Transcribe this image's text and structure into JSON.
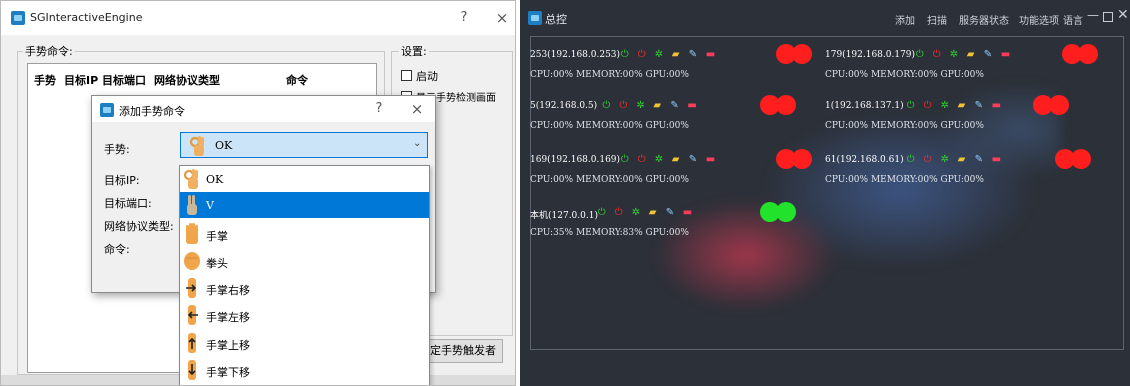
{
  "left_window": {
    "title": "SGInteractiveEngine",
    "help": "?",
    "close": "×",
    "gesture_cmd_group": "手势命令:",
    "table_headers": [
      "手势",
      "目标IP",
      "目标端口",
      "网络协议类型",
      "命令"
    ],
    "settings_group": "设置:",
    "checkbox_start": "启动",
    "checkbox_show": "显示手势检测画面",
    "bottom_button": "定手势触发者"
  },
  "dialog": {
    "title": "添加手势命令",
    "help": "?",
    "close": "×",
    "label_gesture": "手势:",
    "label_ip": "目标IP:",
    "label_port": "目标端口:",
    "label_protocol": "网络协议类型:",
    "label_command": "命令:",
    "combo_value": "OK",
    "options": [
      "OK",
      "V",
      "手掌",
      "拳头",
      "手掌右移",
      "手掌左移",
      "手掌上移",
      "手掌下移"
    ]
  },
  "right_window": {
    "title": "总控",
    "menu": [
      "添加",
      "扫描",
      "服务器状态",
      "功能选项",
      "语言"
    ],
    "servers": [
      {
        "name": "253(192.168.0.253)",
        "stats": "CPU:00% MEMORY:00% GPU:00%",
        "status": "red"
      },
      {
        "name": "179(192.168.0.179)",
        "stats": "CPU:00% MEMORY:00% GPU:00%",
        "status": "red"
      },
      {
        "name": "5(192.168.0.5)",
        "stats": "CPU:00% MEMORY:00% GPU:00%",
        "status": "red"
      },
      {
        "name": "1(192.168.137.1)",
        "stats": "CPU:00% MEMORY:00% GPU:00%",
        "status": "red"
      },
      {
        "name": "169(192.168.0.169)",
        "stats": "CPU:00% MEMORY:00% GPU:00%",
        "status": "red"
      },
      {
        "name": "61(192.168.0.61)",
        "stats": "CPU:00% MEMORY:00% GPU:00%",
        "status": "red"
      },
      {
        "name": "本机(127.0.0.1)",
        "stats": "CPU:35% MEMORY:83% GPU:00%",
        "status": "green"
      }
    ],
    "colors": {
      "status_red": "#ff1e1e",
      "status_green": "#22e22b",
      "bg": "#2c3038"
    }
  }
}
